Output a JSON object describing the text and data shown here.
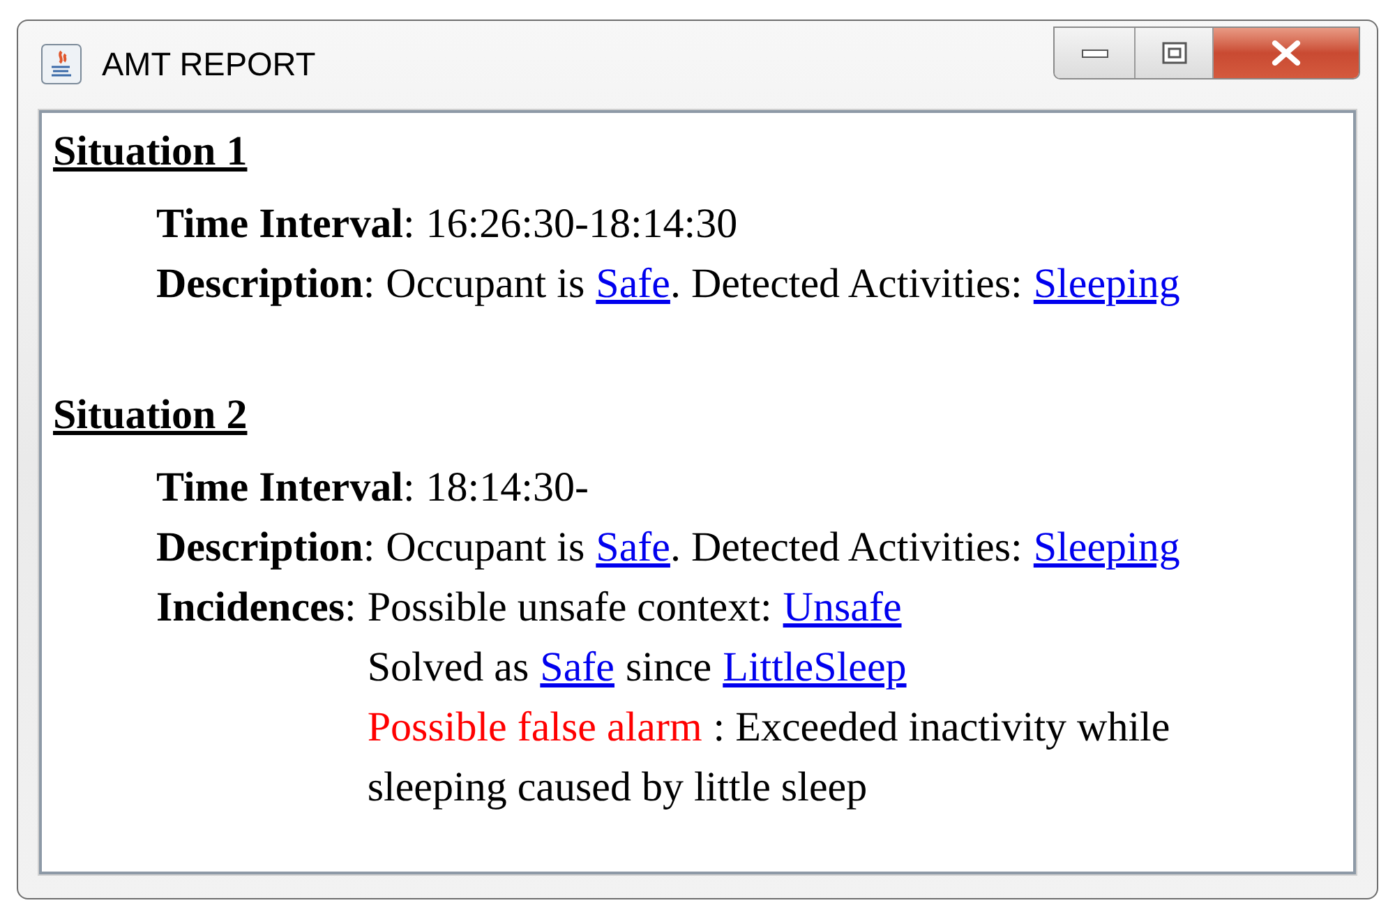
{
  "window": {
    "title": "AMT REPORT"
  },
  "situations": [
    {
      "heading": "Situation 1",
      "fields": [
        {
          "label": "**Time Interval**:",
          "lines": [
            [
              {
                "kind": "text",
                "text": "16:26:30-18:14:30"
              }
            ]
          ]
        },
        {
          "label": "**Description**:",
          "lines": [
            [
              {
                "kind": "text",
                "text": "Occupant is"
              },
              {
                "kind": "link",
                "text": "Safe"
              },
              {
                "kind": "text",
                "text": ". Detected Activities:"
              },
              {
                "kind": "link",
                "text": "Sleeping"
              }
            ]
          ]
        }
      ]
    },
    {
      "heading": "Situation 2",
      "fields": [
        {
          "label": "**Time Interval**:",
          "lines": [
            [
              {
                "kind": "text",
                "text": "18:14:30-"
              }
            ]
          ]
        },
        {
          "label": "**Description**:",
          "lines": [
            [
              {
                "kind": "text",
                "text": "Occupant is"
              },
              {
                "kind": "link",
                "text": "Safe"
              },
              {
                "kind": "text",
                "text": ". Detected Activities:"
              },
              {
                "kind": "link",
                "text": "Sleeping"
              }
            ]
          ]
        },
        {
          "label": "**Incidences**:",
          "lines": [
            [
              {
                "kind": "text",
                "text": "Possible unsafe context:"
              },
              {
                "kind": "link",
                "text": "Unsafe"
              }
            ],
            [
              {
                "kind": "text",
                "text": "Solved as"
              },
              {
                "kind": "link",
                "text": "Safe"
              },
              {
                "kind": "text",
                "text": "since"
              },
              {
                "kind": "link",
                "text": "LittleSleep"
              }
            ],
            [
              {
                "kind": "alarm",
                "text": "Possible false alarm"
              },
              {
                "kind": "text",
                "text": ": Exceeded inactivity while"
              }
            ],
            [
              {
                "kind": "text",
                "text": "sleeping caused by little sleep"
              }
            ]
          ]
        }
      ]
    }
  ]
}
